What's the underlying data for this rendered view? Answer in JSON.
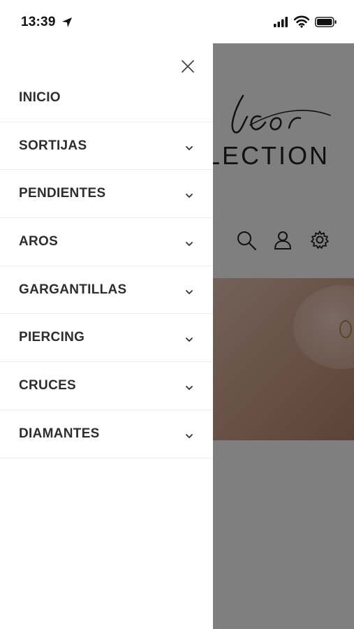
{
  "status_bar": {
    "time": "13:39",
    "icons": [
      "location-arrow-icon",
      "cellular-signal-icon",
      "wifi-icon",
      "battery-icon"
    ]
  },
  "background_page": {
    "logo_script": "lcor",
    "logo_word": "LECTION",
    "header_icons": [
      "search-icon",
      "account-icon",
      "settings-gear-icon"
    ],
    "overlay_color": "rgba(0,0,0,0.5)"
  },
  "drawer": {
    "close_icon": "close-icon",
    "items": [
      {
        "label": "INICIO",
        "has_submenu": false
      },
      {
        "label": "SORTIJAS",
        "has_submenu": true
      },
      {
        "label": "PENDIENTES",
        "has_submenu": true
      },
      {
        "label": "AROS",
        "has_submenu": true
      },
      {
        "label": "GARGANTILLAS",
        "has_submenu": true
      },
      {
        "label": "PIERCING",
        "has_submenu": true
      },
      {
        "label": "CRUCES",
        "has_submenu": true
      },
      {
        "label": "DIAMANTES",
        "has_submenu": true
      }
    ]
  },
  "colors": {
    "drawer_bg": "#ffffff",
    "text": "#2e2e2e",
    "divider": "#ececec"
  }
}
